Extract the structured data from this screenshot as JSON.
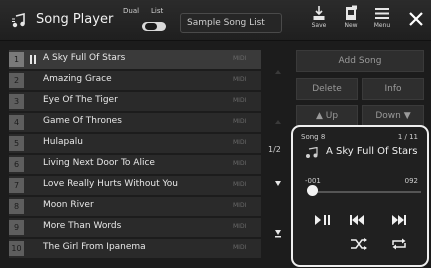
{
  "header": {
    "title": "Song Player",
    "mode_dual": "Dual",
    "mode_list": "List",
    "list_name": "Sample Song List",
    "save_label": "Save",
    "new_label": "New",
    "menu_label": "Menu"
  },
  "songs": [
    {
      "no": "1",
      "name": "A Sky Full Of Stars",
      "type": "MIDI"
    },
    {
      "no": "2",
      "name": "Amazing Grace",
      "type": "MIDI"
    },
    {
      "no": "3",
      "name": "Eye Of The Tiger",
      "type": "MIDI"
    },
    {
      "no": "4",
      "name": "Game Of Thrones",
      "type": "MIDI"
    },
    {
      "no": "5",
      "name": "Hulapalu",
      "type": "MIDI"
    },
    {
      "no": "6",
      "name": "Living Next Door To Alice",
      "type": "MIDI"
    },
    {
      "no": "7",
      "name": "Love Really Hurts Without You",
      "type": "MIDI"
    },
    {
      "no": "8",
      "name": "Moon River",
      "type": "MIDI"
    },
    {
      "no": "9",
      "name": "More Than Words",
      "type": "MIDI"
    },
    {
      "no": "10",
      "name": "The Girl From Ipanema",
      "type": "MIDI"
    }
  ],
  "page_indicator": "1/2",
  "right_panel": {
    "add_song": "Add Song",
    "delete": "Delete",
    "info": "Info",
    "up": "Up",
    "down": "Down"
  },
  "player": {
    "song_no": "Song 8",
    "count": "1 / 11",
    "title": "A Sky Full Of Stars",
    "position": "-001",
    "length": "092",
    "progress_fraction": 0.0
  }
}
